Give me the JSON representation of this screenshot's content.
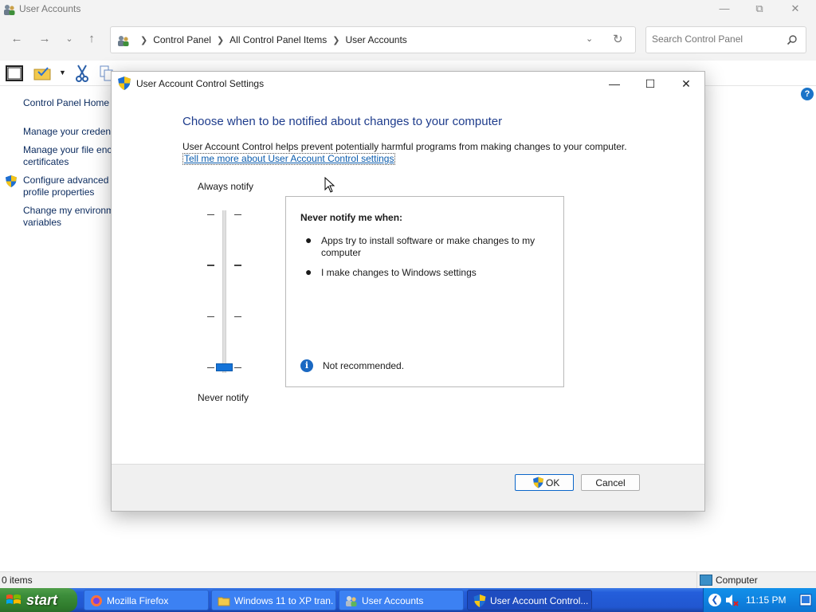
{
  "explorer": {
    "title": "User Accounts",
    "breadcrumb": [
      "Control Panel",
      "All Control Panel Items",
      "User Accounts"
    ],
    "search_placeholder": "Search Control Panel",
    "left_pane": {
      "home": "Control Panel Home",
      "links": [
        "Manage your credentials",
        "Manage your file encryption certificates",
        "Configure advanced user profile properties",
        "Change my environment variables"
      ],
      "link_lines": [
        [
          "Manage your credent"
        ],
        [
          "Manage your file enc",
          "certificates"
        ],
        [
          "Configure advanced",
          "profile properties"
        ],
        [
          "Change my environm",
          "variables"
        ]
      ]
    },
    "status": {
      "items": "0 items",
      "location": "Computer"
    }
  },
  "uac": {
    "title": "User Account Control Settings",
    "heading": "Choose when to be notified about changes to your computer",
    "description": "User Account Control helps prevent potentially harmful programs from making changes to your computer.",
    "link": "Tell me more about User Account Control settings",
    "slider": {
      "top_label": "Always notify",
      "bottom_label": "Never notify",
      "levels": 4,
      "selected_level": 1
    },
    "info": {
      "title": "Never notify me when:",
      "bullets": [
        "Apps try to install software or make changes to my computer",
        "I make changes to Windows settings"
      ],
      "note": "Not recommended."
    },
    "buttons": {
      "ok": "OK",
      "cancel": "Cancel"
    }
  },
  "taskbar": {
    "start_label": "start",
    "tasks": [
      {
        "label": "Mozilla Firefox",
        "icon": "firefox-icon",
        "active": false
      },
      {
        "label": "Windows 11 to XP tran...",
        "icon": "folder-icon",
        "active": false
      },
      {
        "label": "User Accounts",
        "icon": "user-accounts-icon",
        "active": false
      },
      {
        "label": "User Account Control...",
        "icon": "uac-shield-icon",
        "active": true
      }
    ],
    "clock": "11:15 PM"
  },
  "colors": {
    "heading_blue": "#1e3c8c",
    "link_blue": "#0b5cad",
    "slider_thumb": "#1473d8",
    "taskbar_blue": "#245edb",
    "start_green": "#3c8d3b"
  }
}
